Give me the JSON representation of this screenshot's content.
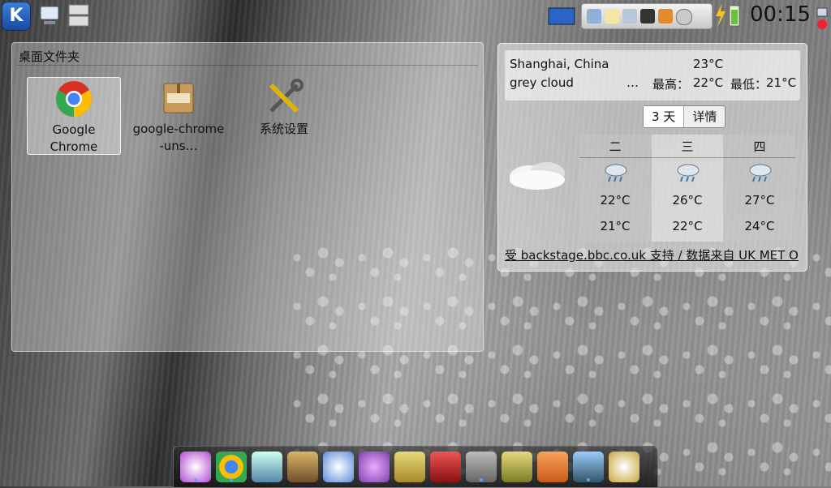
{
  "panel": {
    "clock": "00:15",
    "launcher_icon": "kde-launcher-icon"
  },
  "folder_view": {
    "title": "桌面文件夹",
    "items": [
      {
        "label": "Google Chrome",
        "icon": "chrome-icon"
      },
      {
        "label": "google-chrome-uns…",
        "icon": "deb-package-icon"
      },
      {
        "label": "系统设置",
        "icon": "tools-icon"
      }
    ]
  },
  "weather": {
    "location": "Shanghai, China",
    "condition": "grey cloud",
    "temperature": "23°C",
    "ellipsis": "…",
    "high_label": "最高：",
    "high_value": "22°C",
    "low_label": "最低：",
    "low_value": "21°C",
    "tabs": [
      "3 天",
      "详情"
    ],
    "days": [
      {
        "day": "二",
        "high": "22°C",
        "low": "21°C"
      },
      {
        "day": "三",
        "high": "26°C",
        "low": "22°C"
      },
      {
        "day": "四",
        "high": "27°C",
        "low": "24°C"
      }
    ],
    "credit": "受 backstage.bbc.co.uk 支持 / 数据来自 UK MET O"
  },
  "dock_icons": [
    "purple-star-icon",
    "chrome-icon",
    "media-icon",
    "gimp-icon",
    "network-icon",
    "pidgin-icon",
    "kits-icon",
    "terminal-icon",
    "file-cabinet-icon",
    "package-icon",
    "rss-icon",
    "desktop-icon",
    "disc-icon"
  ],
  "colors": {
    "dock_dot": "#5aa0ff",
    "launcher": "#2a62c0"
  }
}
